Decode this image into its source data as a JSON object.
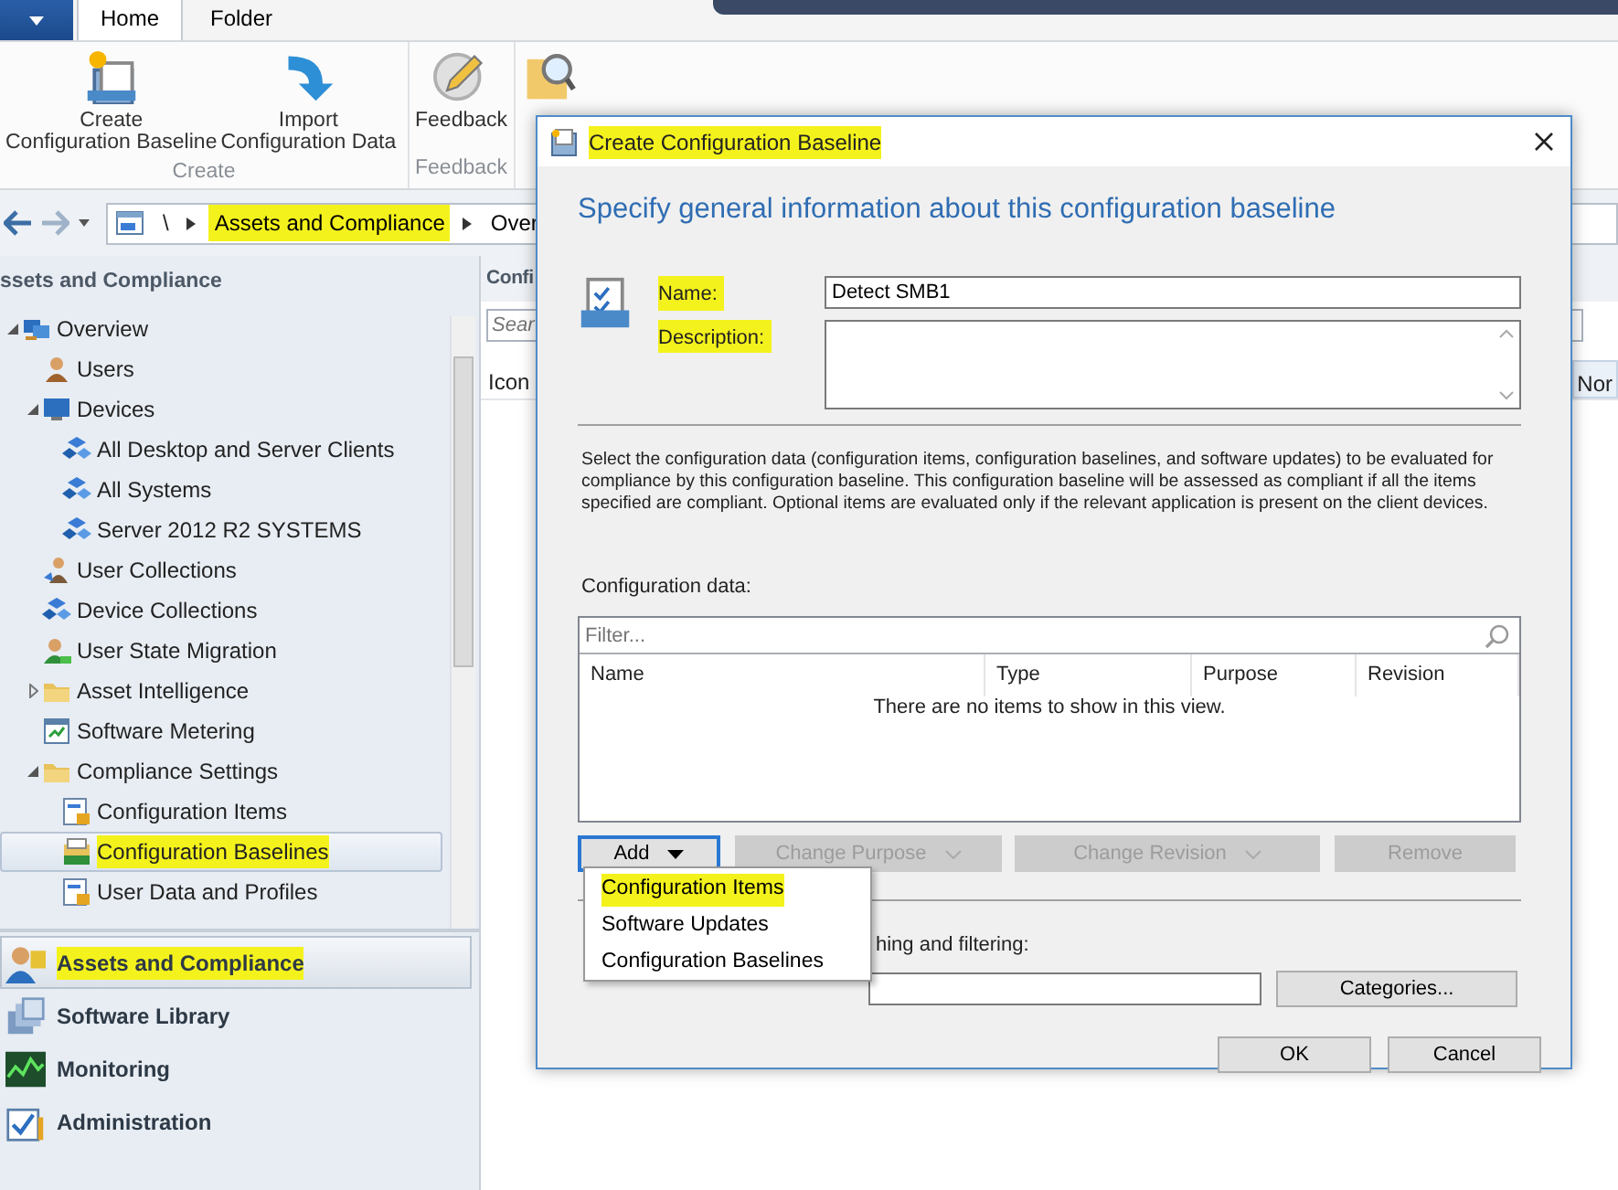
{
  "ribbon": {
    "tabs": [
      {
        "label": "Home",
        "selected": true
      },
      {
        "label": "Folder",
        "selected": false
      }
    ],
    "groups": [
      {
        "label": "Create",
        "buttons": [
          {
            "kind": "create",
            "lines": [
              "Create",
              "Configuration Baseline"
            ]
          },
          {
            "kind": "import",
            "lines": [
              "Import",
              "Configuration Data"
            ]
          }
        ]
      },
      {
        "label": "Feedback",
        "buttons": [
          {
            "kind": "feedback",
            "lines": [
              "Feedback"
            ]
          }
        ]
      },
      {
        "buttons": [
          {
            "kind": "search"
          }
        ]
      }
    ]
  },
  "address_bar": {
    "root": "\\",
    "segments": [
      {
        "label": "Assets and Compliance",
        "highlighted": true
      },
      {
        "label": "Over",
        "highlighted": false
      }
    ]
  },
  "navigation": {
    "title": "ssets and Compliance",
    "tree": [
      {
        "label": "Overview",
        "kind": "overview",
        "expanded": true,
        "selected": false,
        "highlighted": false,
        "children": [
          {
            "label": "Users",
            "kind": "user",
            "selected": false,
            "highlighted": false
          },
          {
            "label": "Devices",
            "kind": "devices",
            "expanded": true,
            "selected": false,
            "highlighted": false,
            "children": [
              {
                "label": "All Desktop and Server Clients",
                "kind": "collection",
                "selected": false,
                "highlighted": false
              },
              {
                "label": "All Systems",
                "kind": "collection",
                "selected": false,
                "highlighted": false
              },
              {
                "label": "Server 2012  R2 SYSTEMS",
                "kind": "collection",
                "selected": false,
                "highlighted": false
              }
            ]
          },
          {
            "label": "User Collections",
            "kind": "usercollection",
            "selected": false,
            "highlighted": false
          },
          {
            "label": "Device Collections",
            "kind": "collection",
            "selected": false,
            "highlighted": false
          },
          {
            "label": "User State Migration",
            "kind": "migration",
            "selected": false,
            "highlighted": false
          },
          {
            "label": "Asset Intelligence",
            "kind": "folder",
            "expanded": false,
            "selected": false,
            "highlighted": false
          },
          {
            "label": "Software Metering",
            "kind": "metering",
            "selected": false,
            "highlighted": false
          },
          {
            "label": "Compliance Settings",
            "kind": "folder",
            "expanded": true,
            "selected": false,
            "highlighted": false,
            "children": [
              {
                "label": "Configuration Items",
                "kind": "configitem",
                "selected": false,
                "highlighted": false
              },
              {
                "label": "Configuration Baselines",
                "kind": "baseline",
                "selected": true,
                "highlighted": true
              },
              {
                "label": "User Data and Profiles",
                "kind": "configitem",
                "selected": false,
                "highlighted": false
              }
            ]
          }
        ]
      }
    ],
    "workspaces": [
      {
        "label": "Assets and Compliance",
        "kind": "assets",
        "selected": true,
        "highlighted": true
      },
      {
        "label": "Software Library",
        "kind": "library",
        "selected": false,
        "highlighted": false
      },
      {
        "label": "Monitoring",
        "kind": "monitoring",
        "selected": false,
        "highlighted": false
      },
      {
        "label": "Administration",
        "kind": "administration",
        "selected": false,
        "highlighted": false
      }
    ]
  },
  "results_pane": {
    "title": "Confi",
    "search_placeholder": "Sear",
    "columns": [
      "Icon",
      "Nor"
    ]
  },
  "dialog": {
    "title": "Create Configuration Baseline",
    "title_highlighted": true,
    "heading": "Specify general information about this configuration baseline",
    "fields": [
      {
        "kind": "text",
        "label": "Name:",
        "label_highlighted": true,
        "value": "Detect SMB1"
      },
      {
        "kind": "textarea",
        "label": "Description:",
        "label_highlighted": true
      }
    ],
    "instructions": "Select the configuration data (configuration items, configuration baselines, and software updates) to be evaluated for compliance by this configuration baseline. This configuration baseline will be assessed as compliant if all the items specified are compliant. Optional items are evaluated only if the relevant application is present on the client devices.",
    "config_data": {
      "label": "Configuration data:",
      "filter_placeholder": "Filter...",
      "columns": [
        "Name",
        "Type",
        "Purpose",
        "Revision"
      ],
      "empty_text": "There are no items to show in this view."
    },
    "actions": [
      {
        "label": "Add",
        "dropdown": true,
        "disabled": false,
        "focused": true
      },
      {
        "label": "Change Purpose",
        "dropdown": true,
        "disabled": true,
        "focused": false
      },
      {
        "label": "Change Revision",
        "dropdown": true,
        "disabled": true,
        "focused": false
      },
      {
        "label": "Remove",
        "dropdown": false,
        "disabled": true,
        "focused": false
      }
    ],
    "add_menu": [
      {
        "label": "Configuration Items",
        "highlighted": true
      },
      {
        "label": "Software Updates",
        "highlighted": false
      },
      {
        "label": "Configuration Baselines",
        "highlighted": false
      }
    ],
    "categories": {
      "label": "hing and filtering:",
      "button": "Categories..."
    },
    "buttons": [
      "OK",
      "Cancel"
    ]
  }
}
